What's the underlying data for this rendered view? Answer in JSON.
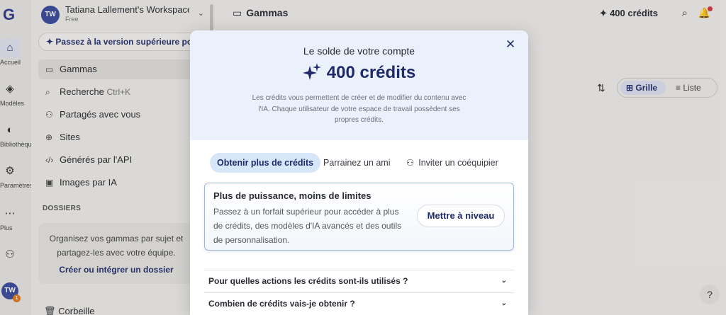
{
  "rail": {
    "logo": "G",
    "items": [
      {
        "label": "Accueil",
        "icon": "home-icon"
      },
      {
        "label": "Modèles",
        "icon": "layers-icon"
      },
      {
        "label": "Bibliothèque",
        "icon": "palette-icon"
      },
      {
        "label": "Paramètres",
        "icon": "gear-icon"
      },
      {
        "label": "Plus",
        "icon": "more-icon"
      },
      {
        "label": "",
        "icon": "add-user-icon"
      }
    ],
    "avatar": "TW",
    "avatar_badge": "1"
  },
  "sidebar": {
    "workspace_initials": "TW",
    "workspace_name": "Tatiana Lallement's Workspace",
    "workspace_plan": "Free",
    "upgrade_label": "Passez à la version supérieure pour",
    "nav": [
      {
        "label": "Gammas",
        "icon": "deck-icon"
      },
      {
        "label": "Recherche",
        "shortcut": "Ctrl+K",
        "icon": "search-icon"
      },
      {
        "label": "Partagés avec vous",
        "icon": "people-icon"
      },
      {
        "label": "Sites",
        "icon": "globe-icon"
      },
      {
        "label": "Générés par l'API",
        "icon": "code-icon"
      },
      {
        "label": "Images par IA",
        "icon": "image-icon"
      }
    ],
    "folders_heading": "DOSSIERS",
    "folders_text": "Organisez vos gammas par sujet et partagez-les avec votre équipe.",
    "folders_link": "Créer ou intégrer un dossier",
    "trash": "Corbeille"
  },
  "header": {
    "title": "Gammas",
    "credits": "400 crédits"
  },
  "view": {
    "grid_label": "Grille",
    "list_label": "Liste"
  },
  "help": "?",
  "modal": {
    "subtitle": "Le solde de votre compte",
    "credits": "400 crédits",
    "description": "Les crédits vous permettent de créer et de modifier du contenu avec l'IA. Chaque utilisateur de votre espace de travail possèdent ses propres crédits.",
    "tabs": [
      "Obtenir plus de crédits",
      "Parrainez un ami",
      "Inviter un coéquipier"
    ],
    "active_tab": 0,
    "upgrade_title": "Plus de puissance, moins de limites",
    "upgrade_text": "Passez à un forfait supérieur pour accéder à plus de crédits, des modèles d'IA avancés et des outils de personnalisation.",
    "upgrade_button": "Mettre à niveau",
    "faq": [
      "Pour quelles actions les crédits sont-ils utilisés ?",
      "Combien de crédits vais-je obtenir ?"
    ]
  },
  "colors": {
    "accent": "#1f2a6b",
    "modal_header_bg": "#eaf1fb",
    "active_tab_bg": "#d7e6f8",
    "notification_dot": "#d9363e"
  }
}
